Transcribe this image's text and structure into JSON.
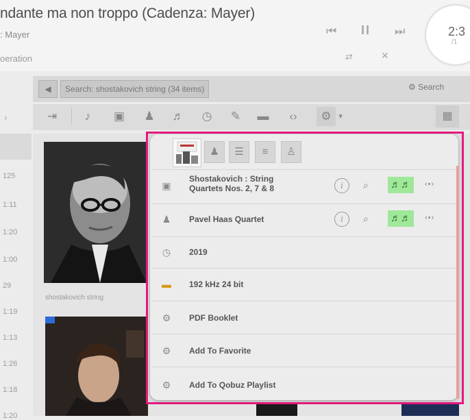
{
  "now_playing": {
    "title": "ndante ma non troppo (Cadenza: Mayer)",
    "artist": ": Mayer",
    "work": "oeration",
    "time_elapsed": "2:3",
    "time_total": "/1"
  },
  "player_controls": {
    "prev_icon": "⏮",
    "pause_icon": "II",
    "next_icon": "⏭",
    "repeat_icon": "⇄",
    "shuffle_icon": "✕"
  },
  "search": {
    "back_icon": "◀",
    "label": "Search: shostakovich string (34 items)",
    "right_label": "⚙ Search"
  },
  "toolbar": {
    "items": [
      "⇥",
      "♪",
      "▣",
      "♟",
      "♬",
      "◷",
      "✎",
      "▬",
      "‹›",
      "⚙"
    ],
    "dropdown_icon": "▾",
    "grid_icon": "▦"
  },
  "track_times": [
    "125",
    "1:11",
    "1:20",
    "1:00",
    "29",
    "1:19",
    "1:13",
    "1:26",
    "1:18",
    "1:20"
  ],
  "albums": [
    {
      "caption": "shostakovich string"
    }
  ],
  "context_menu": {
    "tabs": [
      "cover",
      "artist",
      "align",
      "list",
      "performer"
    ],
    "rows": [
      {
        "icon": "album-icon",
        "label_line1": "Shostakovich : String",
        "label_line2": "Quartets Nos. 2, 7 & 8",
        "has_actions": true
      },
      {
        "icon": "artist-icon",
        "label_line1": "Pavel Haas Quartet",
        "has_actions": true
      },
      {
        "icon": "clock-icon",
        "label_line1": "2019"
      },
      {
        "icon": "folder-icon",
        "label_line1": "192 kHz 24 bit"
      },
      {
        "icon": "gear-icon",
        "label_line1": "PDF Booklet"
      },
      {
        "icon": "gear-icon",
        "label_line1": "Add To Favorite"
      },
      {
        "icon": "gear-icon",
        "label_line1": "Add To Qobuz Playlist"
      }
    ],
    "info_symbol": "i",
    "search_symbol": "⌕",
    "score_symbol": "♬♬",
    "more_symbol": "‹•›"
  },
  "colors": {
    "menu_border": "#e6197d",
    "score_highlight": "#9fe89a",
    "accent_bar": "#e6a09a"
  }
}
